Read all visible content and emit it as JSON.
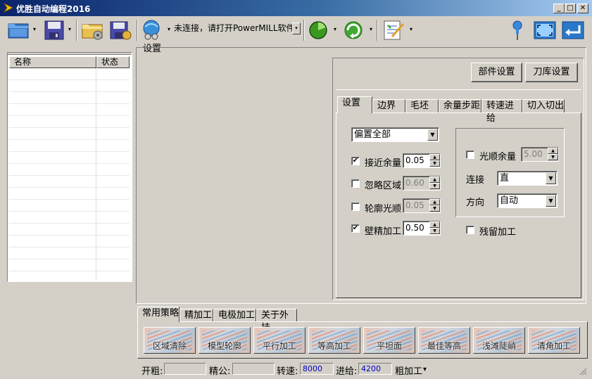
{
  "window": {
    "title": "优胜自动编程2016",
    "min": "_",
    "max": "□",
    "close": "✕"
  },
  "toolbar": {
    "status_text": "未连接，请打开PowerMILL软件",
    "settings_label": "设置",
    "arrow": "▾"
  },
  "list": {
    "col_name": "名称",
    "col_status": "状态"
  },
  "panel": {
    "part_settings": "部件设置",
    "tool_library_settings": "刀库设置",
    "tabs": [
      "设置",
      "边界",
      "毛坯",
      "余量步距",
      "转速进给",
      "切入切出"
    ],
    "offset_select": "偏置全部",
    "approach_allowance": {
      "label": "接近余量",
      "value": "0.05",
      "checked": true
    },
    "ignore_region": {
      "label": "忽略区域",
      "value": "0.60",
      "checked": false
    },
    "contour_smooth": {
      "label": "轮廓光顺",
      "value": "0.05",
      "checked": false
    },
    "wall_finish": {
      "label": "壁精加工",
      "value": "0.50",
      "checked": true
    },
    "smooth_allowance": {
      "label": "光顺余量",
      "value": "5.00",
      "checked": false
    },
    "connect": {
      "label": "连接",
      "value": "直"
    },
    "direction": {
      "label": "方向",
      "value": "自动"
    },
    "residual": {
      "label": "残留加工",
      "checked": false
    }
  },
  "strategy_tabs": [
    "常用策略",
    "精加工",
    "电极加工",
    "关于外挂"
  ],
  "strategies": [
    "区域清除",
    "模型轮廓",
    "平行加工",
    "等高加工",
    "平坦面",
    "最佳等高",
    "浅滩陡峭",
    "清角加工"
  ],
  "statusbar": {
    "rough_label": "开粗:",
    "rough_value": "",
    "tolerance_label": "精公:",
    "tolerance_value": "",
    "speed_label": "转速:",
    "speed_value": "8000",
    "feed_label": "进给:",
    "feed_value": "4200",
    "mode_label": "粗加工",
    "mode_arrow": "▾"
  },
  "colors": {
    "title_start": "#0a246a",
    "title_end": "#a6caf0",
    "face": "#d4d0c8",
    "value_blue": "#0000c0"
  }
}
